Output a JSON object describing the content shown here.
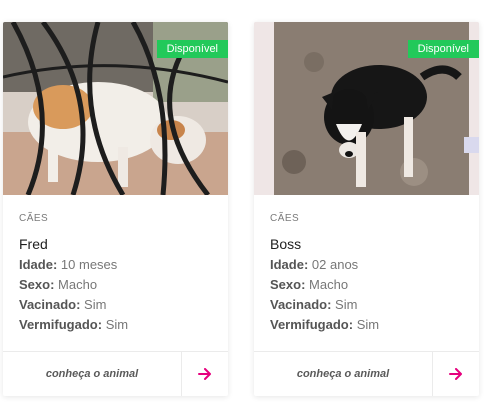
{
  "cards": [
    {
      "status": "Disponível",
      "category": "CÃES",
      "name": "Fred",
      "age_label": "Idade:",
      "age": "10 meses",
      "sex_label": "Sexo:",
      "sex": "Macho",
      "vaccinated_label": "Vacinado:",
      "vaccinated": "Sim",
      "dewormed_label": "Vermifugado:",
      "dewormed": "Sim",
      "cta": "conheça o animal",
      "arrow_icon": "arrow-right-icon"
    },
    {
      "status": "Disponível",
      "category": "CÃES",
      "name": "Boss",
      "age_label": "Idade:",
      "age": "02 anos",
      "sex_label": "Sexo:",
      "sex": "Macho",
      "vaccinated_label": "Vacinado:",
      "vaccinated": "Sim",
      "dewormed_label": "Vermifugado:",
      "dewormed": "Sim",
      "cta": "conheça o animal",
      "arrow_icon": "arrow-right-icon"
    }
  ],
  "colors": {
    "badge": "#22c95a",
    "arrow": "#e6007e"
  }
}
